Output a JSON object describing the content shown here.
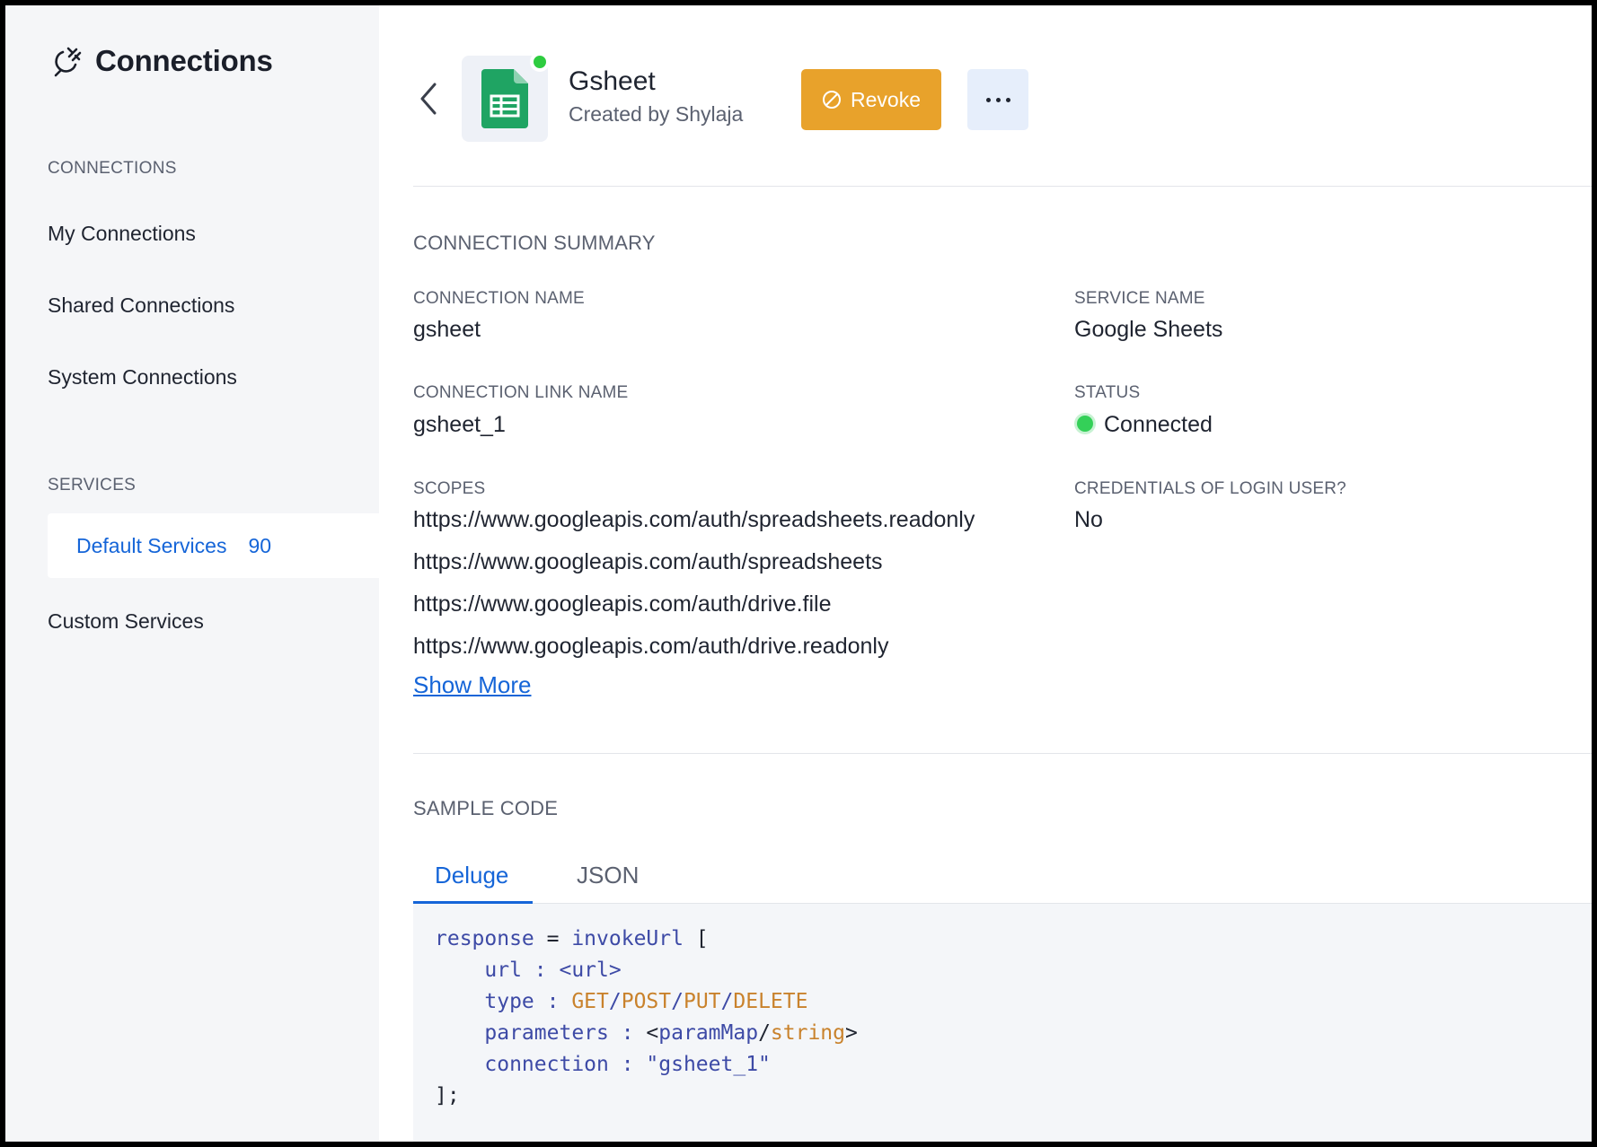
{
  "sidebar": {
    "title": "Connections",
    "section_connections": "CONNECTIONS",
    "items": [
      "My Connections",
      "Shared Connections",
      "System Connections"
    ],
    "section_services": "SERVICES",
    "active_service": {
      "label": "Default Services",
      "count": "90"
    },
    "custom_services": "Custom Services"
  },
  "header": {
    "app_name": "Gsheet",
    "created_by": "Created by Shylaja",
    "revoke_label": "Revoke",
    "more_icon": "more-horizontal-icon",
    "status_indicator_color": "#2ecc40"
  },
  "summary": {
    "title": "CONNECTION SUMMARY",
    "connection_name_label": "CONNECTION NAME",
    "connection_name": "gsheet",
    "service_name_label": "SERVICE NAME",
    "service_name": "Google Sheets",
    "link_name_label": "CONNECTION LINK NAME",
    "link_name": "gsheet_1",
    "status_label": "STATUS",
    "status": "Connected",
    "scopes_label": "SCOPES",
    "scopes": [
      "https://www.googleapis.com/auth/spreadsheets.readonly",
      "https://www.googleapis.com/auth/spreadsheets",
      "https://www.googleapis.com/auth/drive.file",
      "https://www.googleapis.com/auth/drive.readonly"
    ],
    "show_more": "Show More",
    "credentials_label": "CREDENTIALS OF LOGIN USER?",
    "credentials": "No"
  },
  "sample_code": {
    "title": "SAMPLE CODE",
    "tabs": [
      "Deluge",
      "JSON"
    ],
    "active_tab": "Deluge",
    "lines": {
      "l1_var": "response",
      "l1_eq": " = ",
      "l1_fn": "invokeUrl",
      "l1_open": " [",
      "l2_key": "url",
      "l2_sep": " : ",
      "l2_val": "<url>",
      "l3_key": "type",
      "l3_sep": " : ",
      "l3_get": "GET",
      "l3_s1": "/",
      "l3_post": "POST",
      "l3_s2": "/",
      "l3_put": "PUT",
      "l3_s3": "/",
      "l3_delete": "DELETE",
      "l4_key": "parameters",
      "l4_sep": " : ",
      "l4_lt": "<",
      "l4_map": "paramMap",
      "l4_slash": "/",
      "l4_string": "string",
      "l4_gt": ">",
      "l5_key": "connection",
      "l5_sep": " : ",
      "l5_val": "\"gsheet_1\"",
      "l6_close": "];"
    }
  },
  "colors": {
    "accent": "#1565d8",
    "revoke": "#e8a22b",
    "connected": "#34d058",
    "sheets_green": "#1fa463"
  }
}
